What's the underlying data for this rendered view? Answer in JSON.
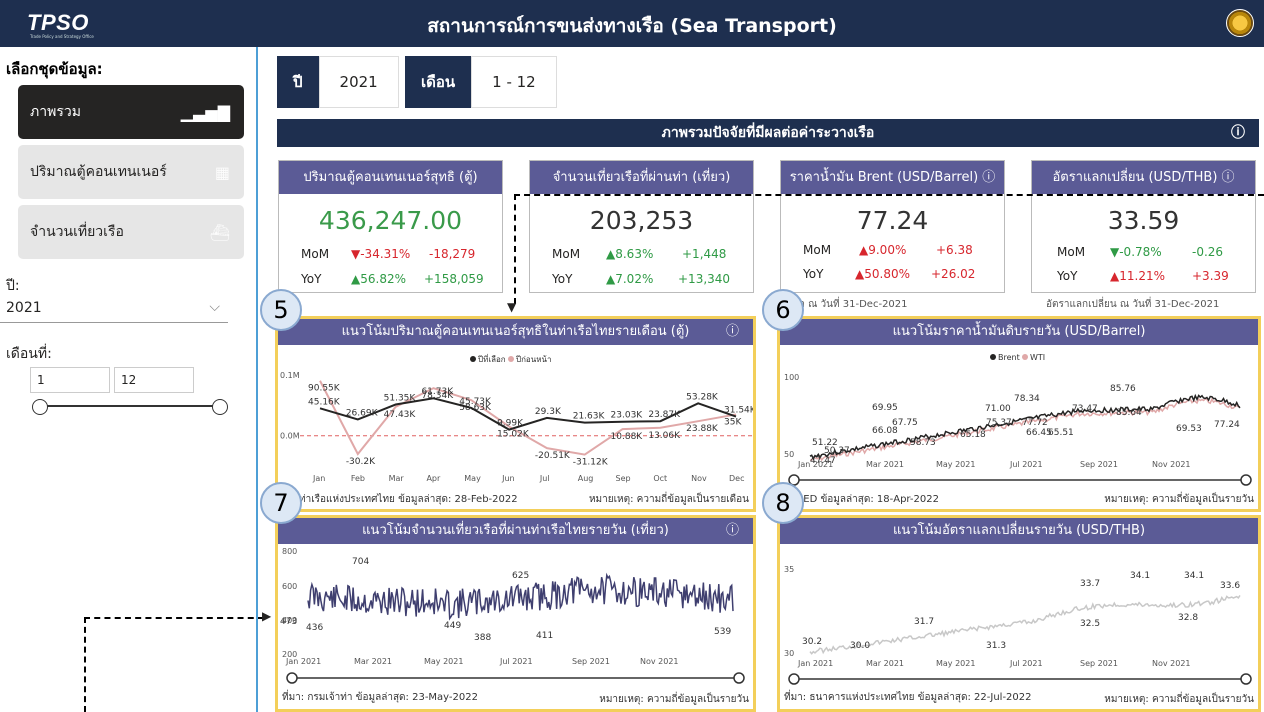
{
  "header": {
    "logo": "TPSO",
    "logo_sub": "Trade Policy and Strategy Office",
    "title": "สถานการณ์การขนส่งทางเรือ (Sea Transport)"
  },
  "sidebar": {
    "title": "เลือกชุดข้อมูล:",
    "items": [
      {
        "label": "ภาพรวม",
        "icon": "bar-chart-icon"
      },
      {
        "label": "ปริมาณตู้คอนเทนเนอร์",
        "icon": "container-ship-icon"
      },
      {
        "label": "จำนวนเที่ยวเรือ",
        "icon": "ship-icon"
      }
    ],
    "year_label": "ปี:",
    "year_value": "2021",
    "month_label": "เดือนที่:",
    "month_from": "1",
    "month_to": "12"
  },
  "filters": {
    "year_key": "ปี",
    "year_value": "2021",
    "month_key": "เดือน",
    "month_value": "1 - 12"
  },
  "banner": {
    "title": "ภาพรวมปัจจัยที่มีผลต่อค่าระวางเรือ",
    "info": "ⓘ"
  },
  "kpis": [
    {
      "title": "ปริมาณตู้คอนเทนเนอร์สุทธิ (ตู้)",
      "value": "436,247.00",
      "mom_label": "MoM",
      "mom_pct": "▼-34.31%",
      "mom_abs": "-18,279",
      "yoy_label": "YoY",
      "yoy_pct": "▲56.82%",
      "yoy_abs": "+158,059"
    },
    {
      "title": "จำนวนเที่ยวเรือที่ผ่านท่า (เที่ยว)",
      "value": "203,253",
      "mom_label": "MoM",
      "mom_pct": "▲8.63%",
      "mom_abs": "+1,448",
      "yoy_label": "YoY",
      "yoy_pct": "▲7.02%",
      "yoy_abs": "+13,340"
    },
    {
      "title": "ราคาน้ำมัน Brent (USD/Barrel) ⓘ",
      "value": "77.24",
      "mom_label": "MoM",
      "mom_pct": "▲9.00%",
      "mom_abs": "+6.38",
      "yoy_label": "YoY",
      "yoy_pct": "▲50.80%",
      "yoy_abs": "+26.02",
      "foot": "าคา ณ วันที่ 31-Dec-2021"
    },
    {
      "title": "อัตราแลกเปลี่ยน (USD/THB) ⓘ",
      "value": "33.59",
      "mom_label": "MoM",
      "mom_pct": "▼-0.78%",
      "mom_abs": "-0.26",
      "yoy_label": "YoY",
      "yoy_pct": "▲11.21%",
      "yoy_abs": "+3.39",
      "foot": "อัตราแลกเปลี่ยน ณ วันที่ 31-Dec-2021"
    }
  ],
  "panels": [
    {
      "badge": "5",
      "title": "แนวโน้มปริมาณตู้คอนเทนเนอร์สุทธิในท่าเรือไทยรายเดือน (ตู้)",
      "info": "ⓘ",
      "foot_left": "การท่าเรือแห่งประเทศไทย  ข้อมูลล่าสุด: 28-Feb-2022",
      "foot_right": "หมายเหตุ: ความถี่ข้อมูลเป็นรายเดือน"
    },
    {
      "badge": "6",
      "title": "แนวโน้มราคาน้ำมันดิบรายวัน (USD/Barrel)",
      "foot_left": ": FRED   ข้อมูลล่าสุด: 18-Apr-2022",
      "foot_right": "หมายเหตุ: ความถี่ข้อมูลเป็นรายวัน"
    },
    {
      "badge": "7",
      "title": "แนวโน้มจำนวนเที่ยวเรือที่ผ่านท่าเรือไทยรายวัน (เที่ยว)",
      "info": "ⓘ",
      "foot_left": "ที่มา: กรมเจ้าท่า   ข้อมูลล่าสุด: 23-May-2022",
      "foot_right": "หมายเหตุ: ความถี่ข้อมูลเป็นรายวัน"
    },
    {
      "badge": "8",
      "title": "แนวโน้มอัตราแลกเปลี่ยนรายวัน (USD/THB)",
      "foot_left": "ที่มา: ธนาคารแห่งประเทศไทย   ข้อมูลล่าสุด: 22-Jul-2022",
      "foot_right": "หมายเหตุ: ความถี่ข้อมูลเป็นรายวัน"
    }
  ],
  "chart_data": [
    {
      "type": "line",
      "legend": [
        "ปีที่เลือก",
        "ปีก่อนหน้า"
      ],
      "categories": [
        "Jan",
        "Feb",
        "Mar",
        "Apr",
        "May",
        "Jun",
        "Jul",
        "Aug",
        "Sep",
        "Oct",
        "Nov",
        "Dec"
      ],
      "yticks": [
        "0.1M",
        "0.0M"
      ],
      "series": [
        {
          "name": "ปีที่เลือก",
          "color": "#252423",
          "values": [
            45.16,
            26.69,
            51.35,
            61.73,
            45.73,
            9.99,
            29.3,
            21.63,
            23.03,
            23.87,
            53.28,
            31.54
          ],
          "labels": [
            "45.16K",
            "26.69K",
            "51.35K",
            "61.73K",
            "45.73K",
            "9.99K",
            "29.3K",
            "21.63K",
            "23.03K",
            "23.87K",
            "53.28K",
            "31.54K"
          ]
        },
        {
          "name": "ปีก่อนหน้า",
          "color": "#e0a8a8",
          "values": [
            90.55,
            -30.2,
            47.43,
            78.34,
            58.63,
            15.02,
            -20.51,
            -31.12,
            10.88,
            13.06,
            23.88,
            35
          ],
          "labels": [
            "90.55K",
            "-30.2K",
            "47.43K",
            "78.34K",
            "58.63K",
            "15.02K",
            "-20.51K",
            "-31.12K",
            "10.88K",
            "13.06K",
            "23.88K",
            "35K"
          ]
        }
      ]
    },
    {
      "type": "line",
      "legend": [
        "Brent",
        "WTI"
      ],
      "xticks": [
        "Jan 2021",
        "Mar 2021",
        "May 2021",
        "Jul 2021",
        "Sep 2021",
        "Nov 2021"
      ],
      "yticks": [
        "100",
        "50"
      ],
      "labels": [
        "51.22",
        "50.37",
        "47.47",
        "69.95",
        "67.75",
        "66.08",
        "58.73",
        "65.18",
        "71.00",
        "78.34",
        "75.37",
        "77.72",
        "66.45",
        "65.51",
        "73.47",
        "85.76",
        "85.64",
        "69.53",
        "77.24"
      ]
    },
    {
      "type": "line",
      "xticks": [
        "Jan 2021",
        "Mar 2021",
        "May 2021",
        "Jul 2021",
        "Sep 2021",
        "Nov 2021"
      ],
      "yticks": [
        "800",
        "600",
        "400",
        "200"
      ],
      "labels": [
        "473",
        "436",
        "704",
        "449",
        "388",
        "625",
        "411",
        "539"
      ]
    },
    {
      "type": "line",
      "xticks": [
        "Jan 2021",
        "Mar 2021",
        "May 2021",
        "Jul 2021",
        "Sep 2021",
        "Nov 2021"
      ],
      "yticks": [
        "35",
        "30"
      ],
      "labels": [
        "30.2",
        "30.0",
        "31.7",
        "31.3",
        "33.7",
        "32.5",
        "34.1",
        "32.8",
        "34.1",
        "33.6"
      ]
    }
  ]
}
